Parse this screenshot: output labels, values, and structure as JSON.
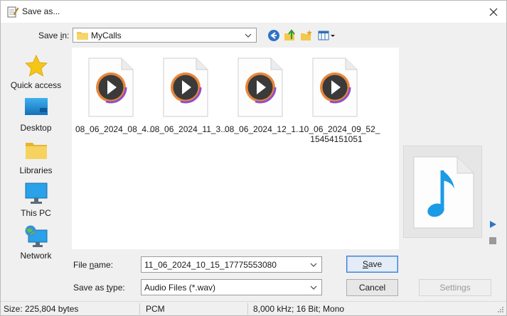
{
  "window": {
    "title": "Save as...",
    "icon": "notepad-pencil-icon"
  },
  "save_in": {
    "label": "Save in:",
    "label_underline_char": "i",
    "folder": "MyCalls",
    "folder_icon": "folder-icon"
  },
  "toolbar": {
    "icons": [
      "back-icon",
      "up-folder-icon",
      "new-folder-icon",
      "view-menu-icon"
    ]
  },
  "places": [
    {
      "label": "Quick access",
      "icon": "star-icon"
    },
    {
      "label": "Desktop",
      "icon": "desktop-icon"
    },
    {
      "label": "Libraries",
      "icon": "libraries-icon"
    },
    {
      "label": "This PC",
      "icon": "this-pc-icon"
    },
    {
      "label": "Network",
      "icon": "network-icon"
    }
  ],
  "files": [
    {
      "name": "08_06_2024_08_4...",
      "icon": "media-play-icon"
    },
    {
      "name": "08_06_2024_11_3...",
      "icon": "media-play-icon"
    },
    {
      "name": "08_06_2024_12_1...",
      "icon": "media-play-icon"
    },
    {
      "name_line1": "10_06_2024_09_52_",
      "name_line2": "15454151051",
      "icon": "media-play-icon"
    }
  ],
  "preview": {
    "icon": "music-note-icon",
    "controls": [
      "play-icon",
      "stop-icon"
    ]
  },
  "file_name": {
    "label_pre": "File ",
    "label_u": "n",
    "label_post": "ame:",
    "value": "11_06_2024_10_15_17775553080"
  },
  "save_as_type": {
    "label_pre": "Save as ",
    "label_u": "t",
    "label_post": "ype:",
    "value": "Audio Files (*.wav)"
  },
  "buttons": {
    "save_u": "S",
    "save_rest": "ave",
    "cancel": "Cancel",
    "settings": "Settings"
  },
  "status": {
    "size": "Size: 225,804 bytes",
    "format": "PCM",
    "details": "8,000 kHz; 16 Bit; Mono"
  },
  "colors": {
    "accent": "#3a7bd5",
    "folder": "#f2c94c",
    "play_ring": "#e8873b",
    "note": "#1a9be6"
  }
}
